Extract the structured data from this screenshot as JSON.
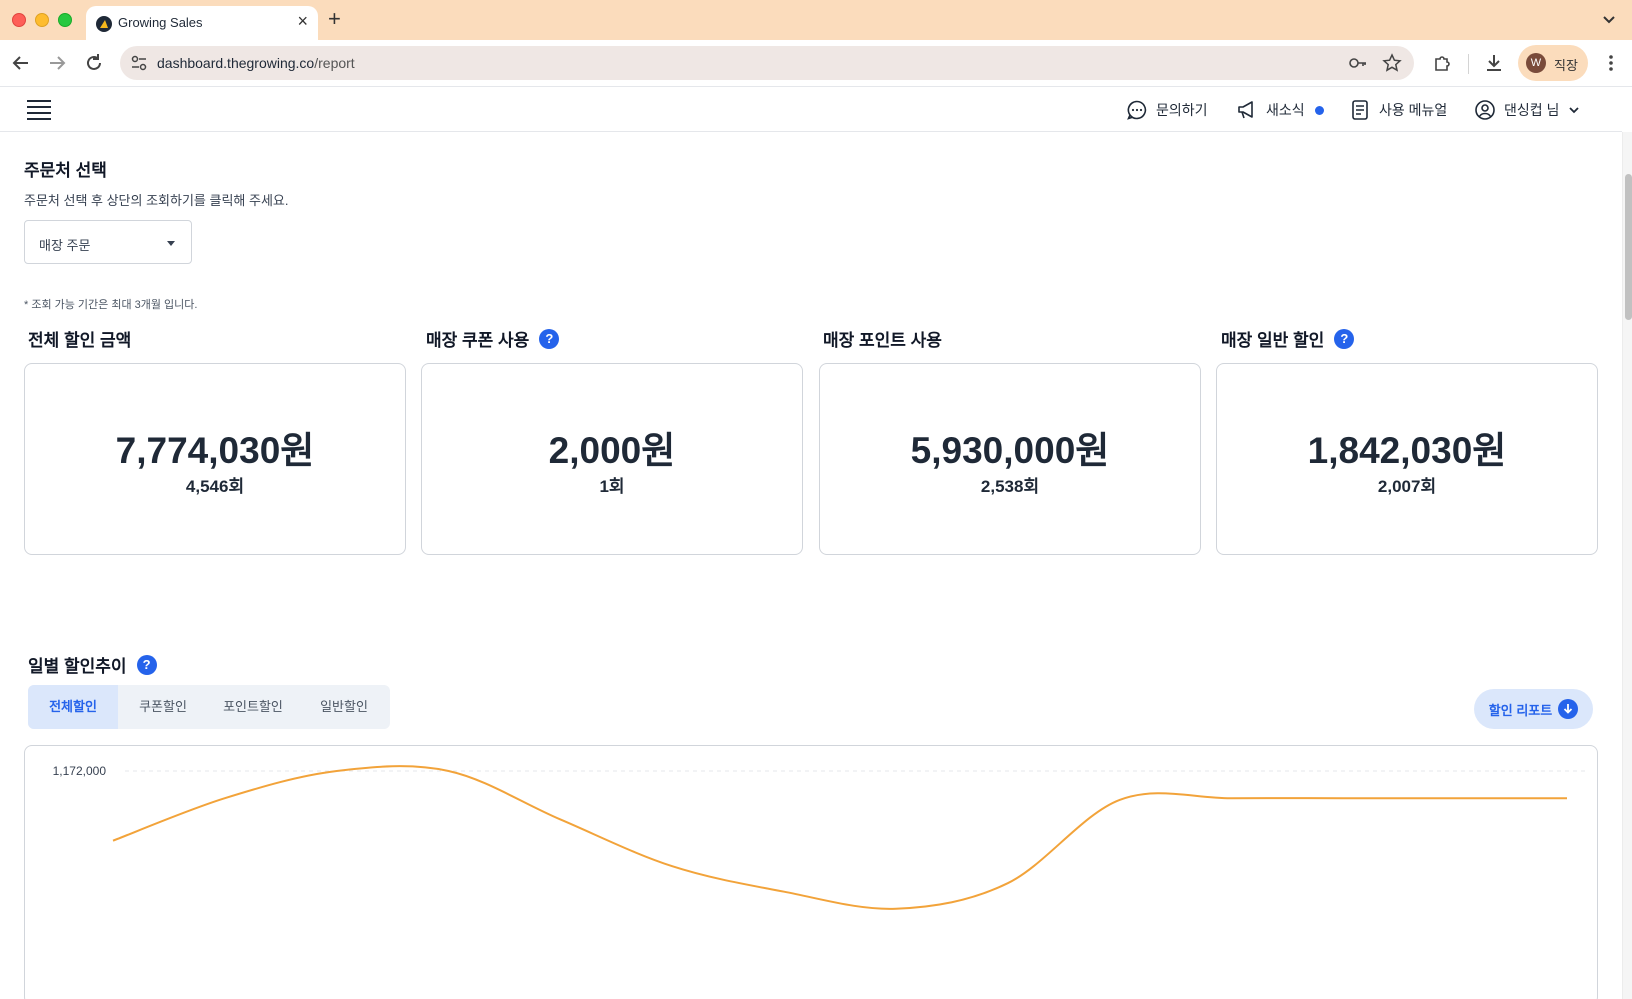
{
  "browser": {
    "tab_title": "Growing Sales",
    "url_host": "dashboard.thegrowing.co",
    "url_path": "/report",
    "profile_initial": "W",
    "profile_name": "직장"
  },
  "header": {
    "inquiry": "문의하기",
    "news": "새소식",
    "manual": "사용 메뉴얼",
    "user": "댄싱컵 님"
  },
  "order_source": {
    "title": "주문처 선택",
    "description": "주문처 선택 후 상단의 조회하기를 클릭해 주세요.",
    "selected": "매장 주문",
    "notice": "* 조회 가능 기간은 최대 3개월 입니다."
  },
  "cards": [
    {
      "label": "전체 할인 금액",
      "amount": "7,774,030원",
      "count": "4,546회",
      "help": false
    },
    {
      "label": "매장 쿠폰 사용",
      "amount": "2,000원",
      "count": "1회",
      "help": true
    },
    {
      "label": "매장 포인트 사용",
      "amount": "5,930,000원",
      "count": "2,538회",
      "help": false
    },
    {
      "label": "매장 일반 할인",
      "amount": "1,842,030원",
      "count": "2,007회",
      "help": true
    }
  ],
  "help_mark": "?",
  "trend": {
    "title": "일별 할인추이",
    "tabs": [
      "전체할인",
      "쿠폰할인",
      "포인트할인",
      "일반할인"
    ],
    "active_tab": 0,
    "report_button": "할인 리포트"
  },
  "chart_data": {
    "type": "line",
    "y_tick_labels": [
      "1,172,000"
    ],
    "ylim_top": 1172000,
    "line_color": "#f2a33a",
    "grid": true,
    "series": [
      {
        "values": [
          1090000,
          1140000,
          1172000,
          1172000,
          1115000,
          1060000,
          1030000,
          1010000,
          1040000,
          1138000,
          1140000,
          1140000,
          1140000,
          1140000
        ]
      }
    ]
  }
}
